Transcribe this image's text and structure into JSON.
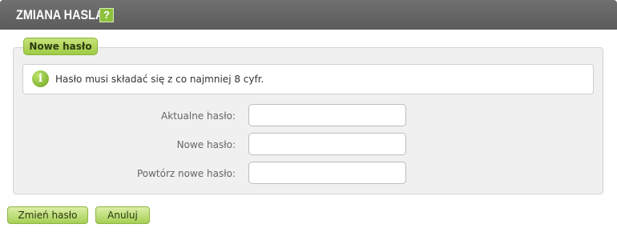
{
  "header": {
    "title": "ZMIANA HASLA",
    "help_icon": "help-icon",
    "help_glyph": "?"
  },
  "form": {
    "section_legend": "Nowe hasło",
    "info": {
      "icon": "info-icon",
      "glyph": "i",
      "text": "Hasło musi składać się z co najmniej 8 cyfr."
    },
    "fields": [
      {
        "label": "Aktualne hasło:",
        "value": ""
      },
      {
        "label": "Nowe hasło:",
        "value": ""
      },
      {
        "label": "Powtórz nowe hasło:",
        "value": ""
      }
    ]
  },
  "actions": {
    "submit_label": "Zmień hasło",
    "cancel_label": "Anuluj"
  },
  "colors": {
    "header_bg": "#666666",
    "accent_green": "#9fcb45",
    "panel_bg": "#f0f0f0"
  }
}
